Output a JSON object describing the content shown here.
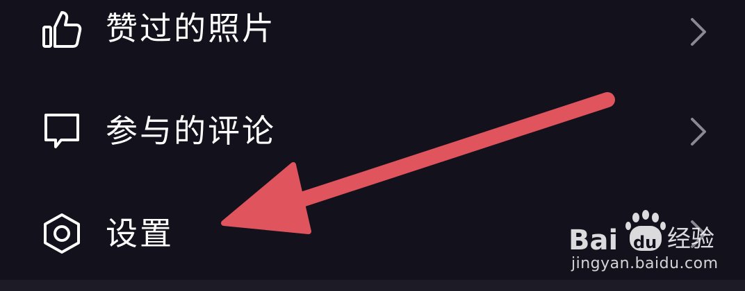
{
  "menu": {
    "items": [
      {
        "label": "赞过的照片",
        "icon": "thumbs-up-icon"
      },
      {
        "label": "参与的评论",
        "icon": "comment-icon"
      },
      {
        "label": "设置",
        "icon": "settings-hexagon-icon"
      }
    ]
  },
  "annotation": {
    "arrow_color": "#e0545e"
  },
  "watermark": {
    "logo_text": "Baidu经验",
    "url": "jingyan.baidu.com"
  },
  "colors": {
    "background": "#13111c",
    "text": "#ffffff",
    "chevron": "#8a8892"
  }
}
